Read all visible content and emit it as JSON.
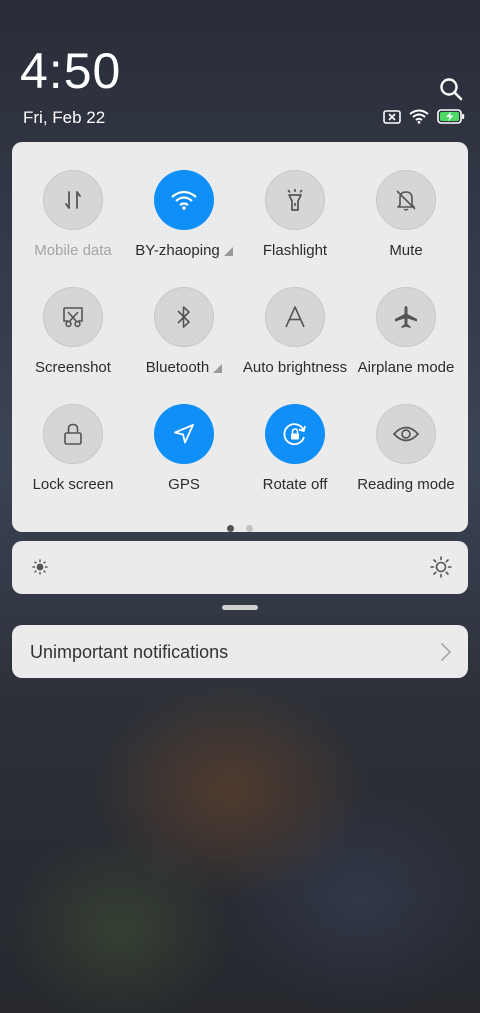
{
  "clock": {
    "time": "4:50",
    "date": "Fri, Feb 22"
  },
  "tiles": [
    {
      "label": "Mobile data",
      "icon": "mobile-data-icon",
      "active": false,
      "dimmed": true,
      "has_arrow": false
    },
    {
      "label": "BY-zhaoping",
      "icon": "wifi-icon",
      "active": true,
      "dimmed": false,
      "has_arrow": true
    },
    {
      "label": "Flashlight",
      "icon": "flashlight-icon",
      "active": false,
      "dimmed": false,
      "has_arrow": false
    },
    {
      "label": "Mute",
      "icon": "bell-off-icon",
      "active": false,
      "dimmed": false,
      "has_arrow": false
    },
    {
      "label": "Screenshot",
      "icon": "screenshot-icon",
      "active": false,
      "dimmed": false,
      "has_arrow": false
    },
    {
      "label": "Bluetooth",
      "icon": "bluetooth-icon",
      "active": false,
      "dimmed": false,
      "has_arrow": true
    },
    {
      "label": "Auto brightness",
      "icon": "auto-brightness-icon",
      "active": false,
      "dimmed": false,
      "has_arrow": false
    },
    {
      "label": "Airplane mode",
      "icon": "airplane-icon",
      "active": false,
      "dimmed": false,
      "has_arrow": false
    },
    {
      "label": "Lock screen",
      "icon": "lock-icon",
      "active": false,
      "dimmed": false,
      "has_arrow": false
    },
    {
      "label": "GPS",
      "icon": "gps-icon",
      "active": true,
      "dimmed": false,
      "has_arrow": false
    },
    {
      "label": "Rotate off",
      "icon": "rotation-lock-icon",
      "active": true,
      "dimmed": false,
      "has_arrow": false
    },
    {
      "label": "Reading mode",
      "icon": "eye-icon",
      "active": false,
      "dimmed": false,
      "has_arrow": false
    }
  ],
  "pagination": {
    "pages": 2,
    "current": 1
  },
  "unimportant": {
    "label": "Unimportant notifications"
  },
  "colors": {
    "accent": "#0f8ff7",
    "panel": "#ebebeb"
  }
}
